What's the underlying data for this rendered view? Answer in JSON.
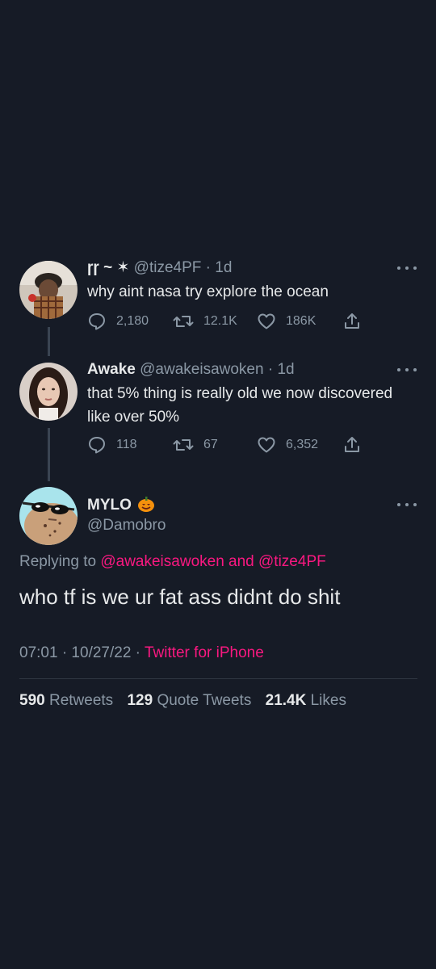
{
  "tweets": [
    {
      "name": "ɼɼ ~ ✶",
      "handle": "@tize4PF",
      "separator": "·",
      "time": "1d",
      "text": "why aint nasa try explore the ocean",
      "replies": "2,180",
      "retweets": "12.1K",
      "likes": "186K"
    },
    {
      "name": "Awake",
      "handle": "@awakeisawoken",
      "separator": "·",
      "time": "1d",
      "text": "that 5% thing is really old we now discovered like over 50%",
      "replies": "118",
      "retweets": "67",
      "likes": "6,352"
    }
  ],
  "main_tweet": {
    "name": "MYLO",
    "name_emoji": "🎃",
    "handle": "@Damobro",
    "replying_prefix": "Replying to",
    "replying_mentions": "@awakeisawoken and @tize4PF",
    "text": "who tf is we ur fat ass didnt do shit",
    "timestamp": "07:01 · 10/27/22",
    "meta_separator": "·",
    "source": "Twitter for iPhone",
    "stats": {
      "retweets_count": "590",
      "retweets_label": "Retweets",
      "quotes_count": "129",
      "quotes_label": "Quote Tweets",
      "likes_count": "21.4K",
      "likes_label": "Likes"
    }
  },
  "icons": {
    "reply": "reply-icon",
    "retweet": "retweet-icon",
    "like": "heart-icon",
    "share": "share-icon",
    "more": "more-icon"
  },
  "colors": {
    "background": "#161b26",
    "text": "#e7e9ea",
    "muted": "#8b98a5",
    "accent": "#f91880"
  }
}
